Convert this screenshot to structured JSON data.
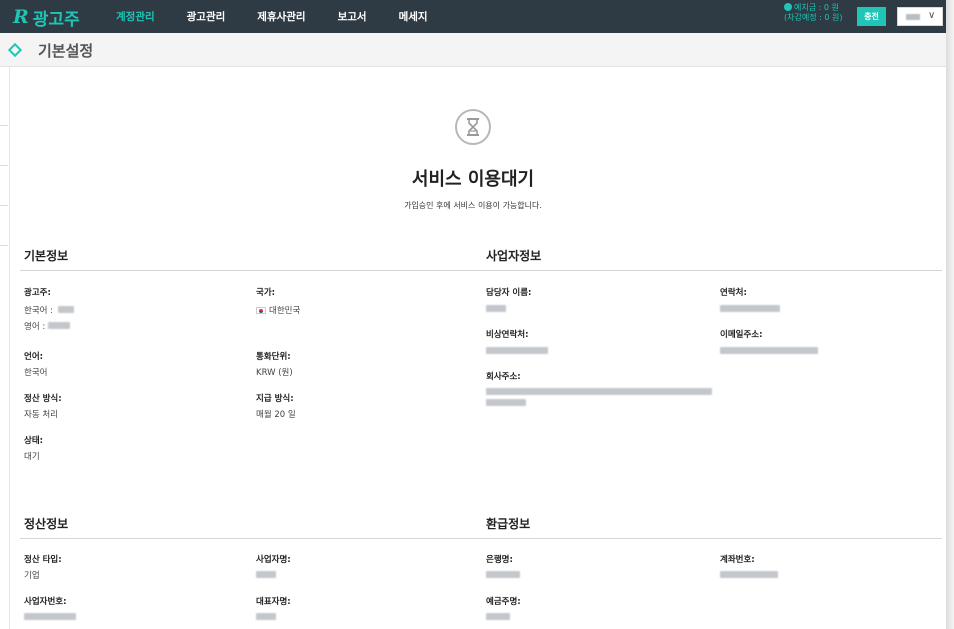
{
  "nav": {
    "logo_text": "광고주",
    "items": [
      {
        "label": "계정관리",
        "active": true
      },
      {
        "label": "광고관리",
        "active": false
      },
      {
        "label": "제휴사관리",
        "active": false
      },
      {
        "label": "보고서",
        "active": false
      },
      {
        "label": "메세지",
        "active": false
      }
    ],
    "deposit_line1": "예치금 : 0 원",
    "deposit_line2": "(차감예정 : 0 원)",
    "charge_label": "충전"
  },
  "page": {
    "title": "기본설정"
  },
  "status": {
    "title": "서비스 이용대기",
    "description": "가입승인 후에 서비스 이용이 가능합니다."
  },
  "basic_info": {
    "title": "기본정보",
    "advertiser_label": "광고주:",
    "advertiser_ko_prefix": "한국어 :",
    "advertiser_en_prefix": "영어 :",
    "country_label": "국가:",
    "country_value": "대한민국",
    "language_label": "언어:",
    "language_value": "한국어",
    "currency_label": "통화단위:",
    "currency_value": "KRW (원)",
    "settle_method_label": "정산 방식:",
    "settle_method_value": "자동 처리",
    "payment_method_label": "지급 방식:",
    "payment_method_value": "매월 20 일",
    "state_label": "상태:",
    "state_value": "대기"
  },
  "business_info": {
    "title": "사업자정보",
    "manager_label": "담당자 이름:",
    "contact_label": "연락처:",
    "emergency_label": "비상연락처:",
    "email_label": "이메일주소:",
    "address_label": "회사주소:"
  },
  "settlement_info": {
    "title": "정산정보",
    "type_label": "정산 타입:",
    "type_value": "기업",
    "biz_name_label": "사업자명:",
    "biz_no_label": "사업자번호:",
    "ceo_label": "대표자명:"
  },
  "refund_info": {
    "title": "환급정보",
    "bank_label": "은행명:",
    "account_label": "계좌번호:",
    "holder_label": "예금주명:"
  },
  "colors": {
    "accent": "#1fc6b5",
    "nav_bg": "#2e3a44"
  }
}
